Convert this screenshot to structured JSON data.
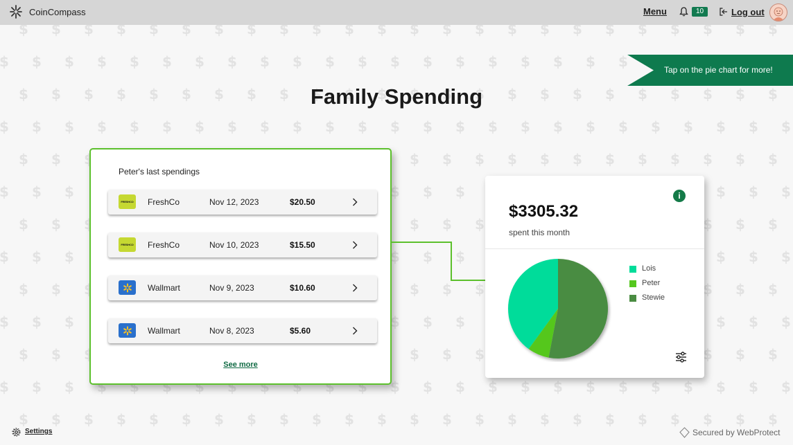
{
  "header": {
    "app_name": "CoinCompass",
    "menu_label": "Menu",
    "notifications_count": "10",
    "logout_label": "Log out",
    "logo_icon": "star-burst-icon",
    "bell_icon": "bell-icon",
    "avatar_icon": "user-avatar"
  },
  "banner": {
    "text": "Tap on the pie chart for more!",
    "color": "#0e7a4e"
  },
  "page_title": "Family Spending",
  "spendings": {
    "title": "Peter's last spendings",
    "rows": [
      {
        "merchant": "FreshCo",
        "logo_text": "FRESHCO",
        "logo_type": "freshco",
        "date": "Nov 12, 2023",
        "amount": "$20.50"
      },
      {
        "merchant": "FreshCo",
        "logo_text": "FRESHCO",
        "logo_type": "freshco",
        "date": "Nov 10, 2023",
        "amount": "$15.50"
      },
      {
        "merchant": "Wallmart",
        "logo_text": "",
        "logo_type": "walmart",
        "date": "Nov 9, 2023",
        "amount": "$10.60"
      },
      {
        "merchant": "Wallmart",
        "logo_text": "",
        "logo_type": "walmart",
        "date": "Nov 8, 2023",
        "amount": "$5.60"
      }
    ],
    "see_more": "See more",
    "border_color": "#5cc02c"
  },
  "summary": {
    "total": "$3305.32",
    "subtitle": "spent this month",
    "info_icon": "i"
  },
  "chart_data": {
    "type": "pie",
    "categories": [
      "Lois",
      "Peter",
      "Stewie"
    ],
    "values": [
      40,
      7,
      53
    ],
    "colors": [
      "#00dc9a",
      "#55c71e",
      "#4a8c42"
    ],
    "legend_position": "right"
  },
  "footer": {
    "settings_label": "Settings",
    "secured_label": "Secured by WebProtect"
  }
}
